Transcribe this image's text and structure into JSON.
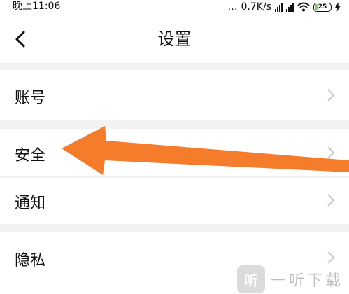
{
  "status_bar": {
    "time": "晚上11:06",
    "net_speed": "0.7K/s",
    "battery": "25",
    "battery_level": 0.25,
    "icons": [
      "signal-icon",
      "signal-icon",
      "wifi-icon",
      "battery-icon",
      "charging-bolt-icon"
    ]
  },
  "header": {
    "title": "设置",
    "back_icon": "back-chevron-icon"
  },
  "settings": {
    "items": [
      {
        "label": "账号",
        "icon": "chevron-right-icon"
      },
      {
        "label": "安全",
        "icon": "chevron-right-icon"
      },
      {
        "label": "通知",
        "icon": "chevron-right-icon"
      },
      {
        "label": "隐私",
        "icon": "chevron-right-icon"
      }
    ]
  },
  "annotation": {
    "color": "#f57c2a",
    "type": "arrow"
  },
  "watermark": {
    "logo": "听",
    "text": "一听下载"
  },
  "colors": {
    "background": "#ffffff",
    "section_gap": "#f2f2f2",
    "chevron": "#c8c8c8",
    "accent": "#f57c2a"
  }
}
